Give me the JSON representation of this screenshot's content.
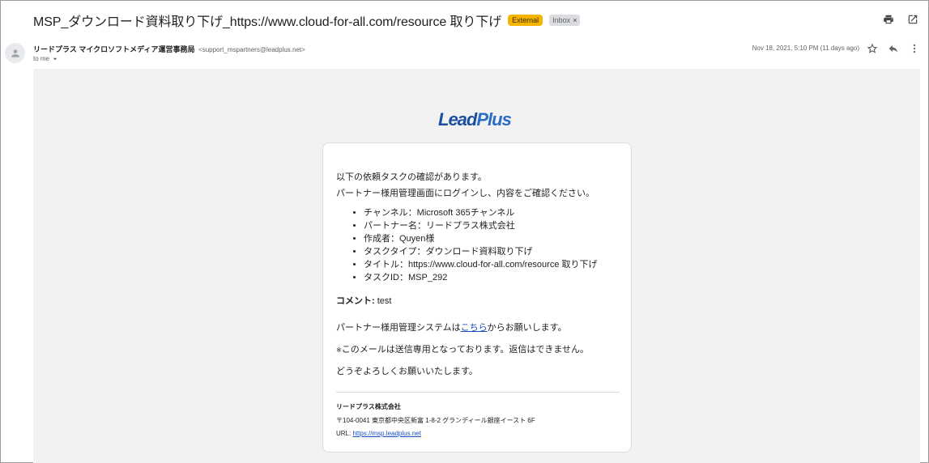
{
  "subject": "MSP_ダウンロード資料取り下げ_https://www.cloud-for-all.com/resource 取り下げ",
  "labels": {
    "external": "External",
    "inbox": "Inbox",
    "inbox_close": "×"
  },
  "sender": {
    "name": "リードプラス マイクロソフトメディア運営事務局",
    "email": "<support_mspartners@leadplus.net>",
    "to": "to me",
    "date": "Nov 18, 2021, 5:10 PM (11 days ago)"
  },
  "logo": {
    "part1": "Lead",
    "part2": "Plus",
    "colors": {
      "primary": "#1b4fa0",
      "accent": "#2a6ec8"
    }
  },
  "body": {
    "intro1": "以下の依頼タスクの確認があります。",
    "intro2": "パートナー様用管理画面にログインし、内容をご確認ください。",
    "items": [
      "チャンネル：Microsoft 365チャンネル",
      "パートナー名：リードプラス株式会社",
      "作成者：Quyen様",
      "タスクタイプ：ダウンロード資料取り下げ",
      "タイトル：https://www.cloud-for-all.com/resource 取り下げ",
      "タスクID：MSP_292"
    ],
    "comment_label": "コメント:",
    "comment_value": " test",
    "system_before": "パートナー様用管理システムは",
    "system_link": "こちら",
    "system_after": "からお願いします。",
    "notice_mark": "※",
    "notice": "このメールは送信専用となっております。返信はできません。",
    "closing": "どうぞよろしくお願いいたします。"
  },
  "footer": {
    "company": "リードプラス株式会社",
    "address": "〒104-0041 東京都中央区新富 1-8-2 グランディール銀座イースト 6F",
    "url_label": "URL: ",
    "url": "https://msp.leadplus.net"
  },
  "icons": {
    "print": "print-icon",
    "open_new": "open-in-new-icon",
    "star": "star-icon",
    "reply": "reply-icon",
    "more": "more-vert-icon",
    "avatar": "person-icon",
    "dropdown": "caret-down-icon"
  },
  "colors": {
    "external_label": "#f5b400",
    "link": "#1a4fc2",
    "mail_bg": "#f2f2f2"
  }
}
